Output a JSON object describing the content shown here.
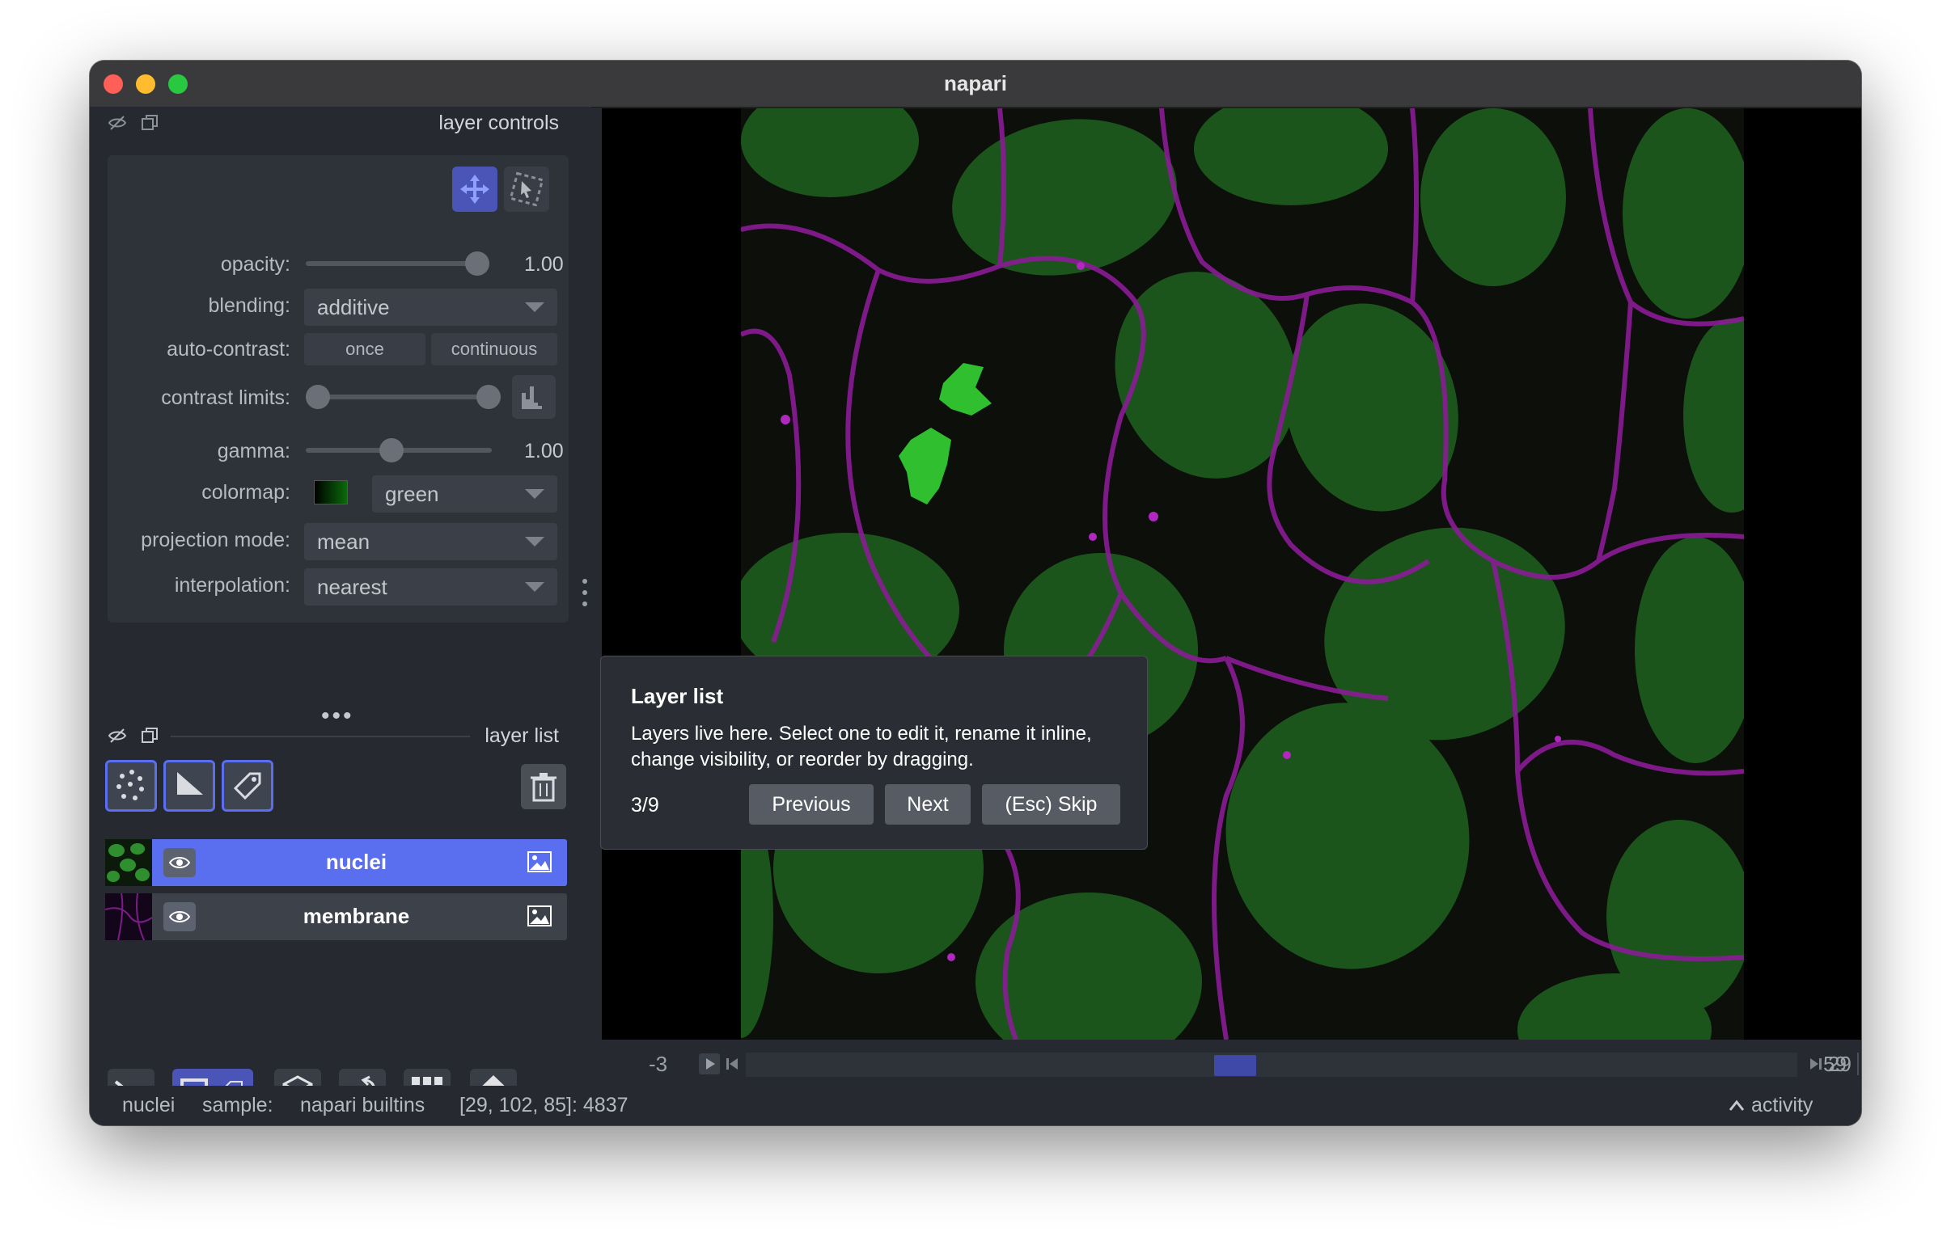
{
  "window": {
    "title": "napari"
  },
  "layer_controls": {
    "header": "layer controls",
    "opacity_label": "opacity:",
    "opacity_value": "1.00",
    "opacity_level": 1.0,
    "blending_label": "blending:",
    "blending_value": "additive",
    "auto_contrast_label": "auto-contrast:",
    "auto_contrast_once": "once",
    "auto_contrast_continuous": "continuous",
    "contrast_limits_label": "contrast limits:",
    "gamma_label": "gamma:",
    "gamma_value": "1.00",
    "colormap_label": "colormap:",
    "colormap_value": "green",
    "projection_label": "projection mode:",
    "projection_value": "mean",
    "interpolation_label": "interpolation:",
    "interpolation_value": "nearest"
  },
  "layer_list": {
    "header": "layer list",
    "layers": [
      {
        "name": "nuclei",
        "selected": true
      },
      {
        "name": "membrane",
        "selected": false
      }
    ]
  },
  "dims_slider": {
    "left_value": "-3",
    "current": "29",
    "max": "59"
  },
  "status": {
    "layer": "nuclei",
    "sample_label": "sample:",
    "sample_value": "napari builtins",
    "coords": "[29, 102, 85]: 4837",
    "activity": "activity"
  },
  "tour": {
    "title": "Layer list",
    "body": "Layers live here. Select one to edit it, rename it inline, change visibility, or reorder by dragging.",
    "step": "3/9",
    "previous": "Previous",
    "next": "Next",
    "skip": "(Esc) Skip"
  },
  "colors": {
    "accent": "#4a55b7",
    "selected_layer": "#5a6ef0",
    "background": "#262930",
    "nuclei": "#1f7a1f",
    "membrane": "#a01ea8"
  }
}
